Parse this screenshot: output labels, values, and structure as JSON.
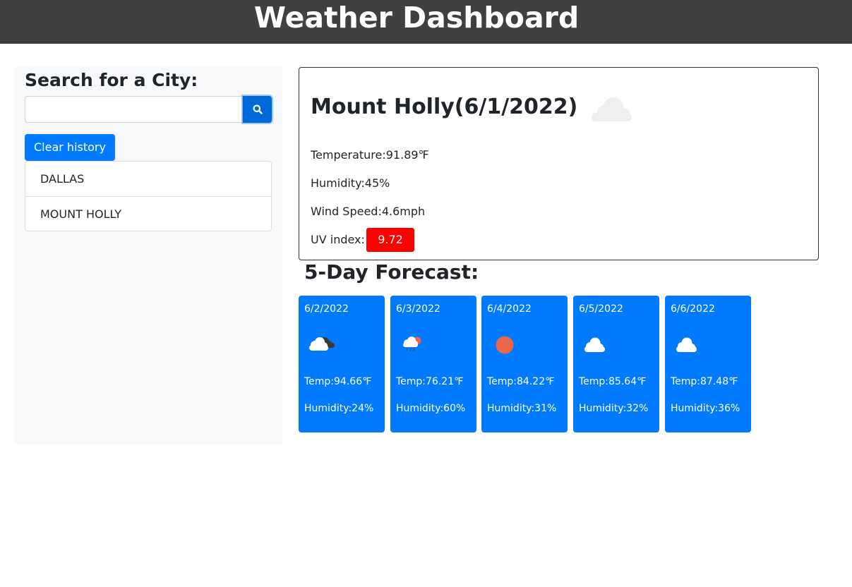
{
  "header": {
    "title": "Weather Dashboard"
  },
  "sidebar": {
    "heading": "Search for a City:",
    "search": {
      "value": "",
      "placeholder": "",
      "button_icon": "search-icon"
    },
    "clear_label": "Clear history",
    "history": [
      {
        "label": "DALLAS"
      },
      {
        "label": "MOUNT HOLLY"
      }
    ]
  },
  "current": {
    "title": "Mount Holly(6/1/2022)",
    "icon": "cloud-icon",
    "temperature": "Temperature:91.89℉",
    "humidity": "Humidity:45%",
    "wind": "Wind Speed:4.6mph",
    "uv_label": "UV index:",
    "uv_value": "9.72",
    "uv_color": "#ff0000"
  },
  "forecast": {
    "title": "5-Day Forecast:",
    "days": [
      {
        "date": "6/2/2022",
        "icon": "cloud-dark-cloud-icon",
        "temp": "Temp:94.66℉",
        "humidity": "Humidity:24%"
      },
      {
        "date": "6/3/2022",
        "icon": "rain-sun-cloud-icon",
        "temp": "Temp:76.21℉",
        "humidity": "Humidity:60%"
      },
      {
        "date": "6/4/2022",
        "icon": "sun-icon",
        "temp": "Temp:84.22℉",
        "humidity": "Humidity:31%"
      },
      {
        "date": "6/5/2022",
        "icon": "cloud-icon",
        "temp": "Temp:85.64℉",
        "humidity": "Humidity:32%"
      },
      {
        "date": "6/6/2022",
        "icon": "cloud-icon",
        "temp": "Temp:87.48℉",
        "humidity": "Humidity:36%"
      }
    ]
  },
  "colors": {
    "header_bg": "#404040",
    "accent": "#007bff",
    "sidebar_bg": "#f8f9fa",
    "uv_high": "#ff0000"
  }
}
